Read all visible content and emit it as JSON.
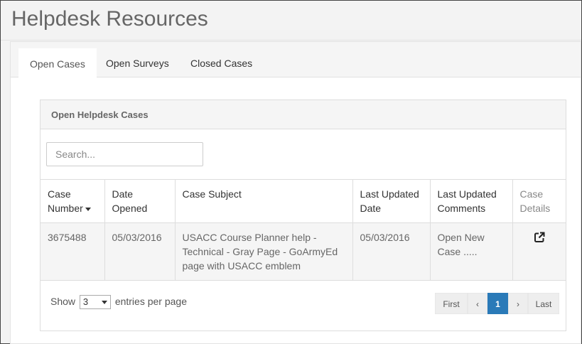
{
  "page": {
    "title": "Helpdesk Resources"
  },
  "tabs": [
    {
      "label": "Open Cases",
      "active": true
    },
    {
      "label": "Open Surveys",
      "active": false
    },
    {
      "label": "Closed Cases",
      "active": false
    }
  ],
  "panel": {
    "heading": "Open Helpdesk Cases",
    "search_placeholder": "Search...",
    "columns": {
      "case_number_1": "Case",
      "case_number_2": "Number",
      "date_opened_1": "Date",
      "date_opened_2": "Opened",
      "case_subject": "Case Subject",
      "last_updated_date_1": "Last Updated",
      "last_updated_date_2": "Date",
      "last_updated_comments_1": "Last Updated",
      "last_updated_comments_2": "Comments",
      "case_details_1": "Case",
      "case_details_2": "Details"
    },
    "rows": [
      {
        "case_number": "3675488",
        "date_opened": "05/03/2016",
        "case_subject": "USACC Course Planner help - Technical - Gray Page - GoArmyEd page with USACC emblem",
        "last_updated_date": "05/03/2016",
        "last_updated_comments": "Open New Case .....",
        "details_icon": "external-link-icon"
      }
    ],
    "footer": {
      "show_label": "Show",
      "entries_value": "3",
      "entries_label": "entries per page"
    },
    "pagination": {
      "first": "First",
      "prev": "‹",
      "current": "1",
      "next": "›",
      "last": "Last"
    }
  },
  "colors": {
    "accent": "#2a7ab8",
    "heading_bg": "#f5f5f5",
    "row_bg": "#f5f5f5"
  }
}
